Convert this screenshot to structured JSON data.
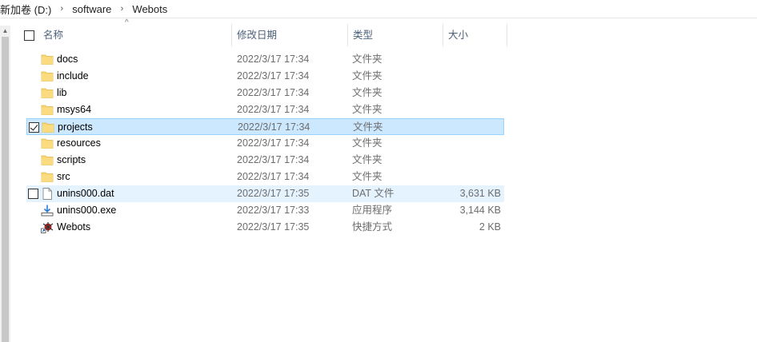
{
  "breadcrumb": {
    "items": [
      "新加卷 (D:)",
      "software",
      "Webots"
    ],
    "separator": "›"
  },
  "columns": {
    "name": "名称",
    "date": "修改日期",
    "type": "类型",
    "size": "大小"
  },
  "files": [
    {
      "name": "docs",
      "date": "2022/3/17 17:34",
      "type": "文件夹",
      "size": "",
      "icon": "folder-icon",
      "state": "normal"
    },
    {
      "name": "include",
      "date": "2022/3/17 17:34",
      "type": "文件夹",
      "size": "",
      "icon": "folder-icon",
      "state": "normal"
    },
    {
      "name": "lib",
      "date": "2022/3/17 17:34",
      "type": "文件夹",
      "size": "",
      "icon": "folder-icon",
      "state": "normal"
    },
    {
      "name": "msys64",
      "date": "2022/3/17 17:34",
      "type": "文件夹",
      "size": "",
      "icon": "folder-icon",
      "state": "normal"
    },
    {
      "name": "projects",
      "date": "2022/3/17 17:34",
      "type": "文件夹",
      "size": "",
      "icon": "folder-icon",
      "state": "selected"
    },
    {
      "name": "resources",
      "date": "2022/3/17 17:34",
      "type": "文件夹",
      "size": "",
      "icon": "folder-icon",
      "state": "normal"
    },
    {
      "name": "scripts",
      "date": "2022/3/17 17:34",
      "type": "文件夹",
      "size": "",
      "icon": "folder-icon",
      "state": "normal"
    },
    {
      "name": "src",
      "date": "2022/3/17 17:34",
      "type": "文件夹",
      "size": "",
      "icon": "folder-icon",
      "state": "normal"
    },
    {
      "name": "unins000.dat",
      "date": "2022/3/17 17:35",
      "type": "DAT 文件",
      "size": "3,631 KB",
      "icon": "file-icon",
      "state": "hover"
    },
    {
      "name": "unins000.exe",
      "date": "2022/3/17 17:33",
      "type": "应用程序",
      "size": "3,144 KB",
      "icon": "installer-icon",
      "state": "normal"
    },
    {
      "name": "Webots",
      "date": "2022/3/17 17:35",
      "type": "快捷方式",
      "size": "2 KB",
      "icon": "webots-shortcut-icon",
      "state": "normal"
    }
  ],
  "colors": {
    "selected_bg": "#cce8ff",
    "selected_border": "#99d1ff",
    "hover_bg": "#e5f3ff",
    "folder": "#f8d775",
    "header_text": "#4c607a"
  }
}
